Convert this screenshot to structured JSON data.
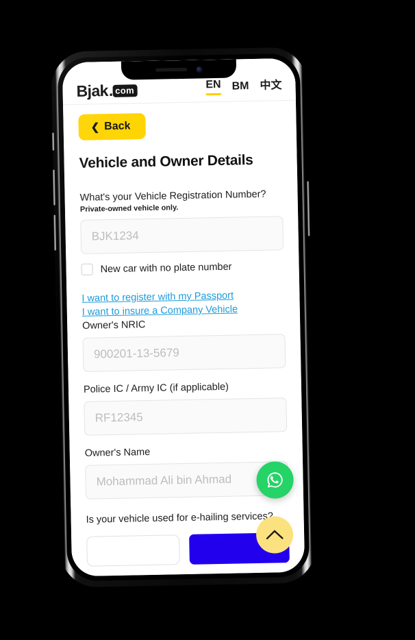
{
  "header": {
    "logo_word": "Bjak",
    "logo_dot": ".",
    "logo_badge": "com",
    "languages": [
      {
        "code": "EN",
        "active": true
      },
      {
        "code": "BM",
        "active": false
      },
      {
        "code": "中文",
        "active": false
      }
    ]
  },
  "nav": {
    "back_label": "Back",
    "back_icon": "chevron-left-icon"
  },
  "main": {
    "page_title": "Vehicle and Owner Details",
    "vehicle_reg": {
      "question": "What's your Vehicle Registration Number?",
      "subtext": "Private-owned vehicle only.",
      "placeholder": "BJK1234",
      "value": ""
    },
    "no_plate_checkbox": {
      "label": "New car with no plate number",
      "checked": false
    },
    "links": [
      {
        "label": "I want to register with my Passport"
      },
      {
        "label": "I want to insure a Company Vehicle"
      }
    ],
    "owner_nric": {
      "label": "Owner's NRIC",
      "placeholder": "900201-13-5679",
      "value": ""
    },
    "police_ic": {
      "label": "Police IC / Army IC (if applicable)",
      "placeholder": "RF12345",
      "value": ""
    },
    "owner_name": {
      "label": "Owner's Name",
      "placeholder": "Mohammad Ali bin Ahmad",
      "value": ""
    },
    "ehailing": {
      "question": "Is your vehicle used for e-hailing services?",
      "option_no_label": "",
      "option_yes_label": ""
    }
  },
  "floating": {
    "whatsapp_icon": "whatsapp-icon",
    "scroll_top_icon": "chevron-up-icon"
  },
  "device": {
    "speaker": "earpiece-speaker",
    "camera": "front-camera"
  },
  "colors": {
    "brand_yellow": "#FFD400",
    "accent_underline": "#FFCE00",
    "link_blue": "#1E9BDB",
    "primary_blue": "#2200EE",
    "whatsapp_green": "#25D366",
    "fab_yellow": "#FCE17F",
    "input_bg": "#FAFAFA"
  }
}
